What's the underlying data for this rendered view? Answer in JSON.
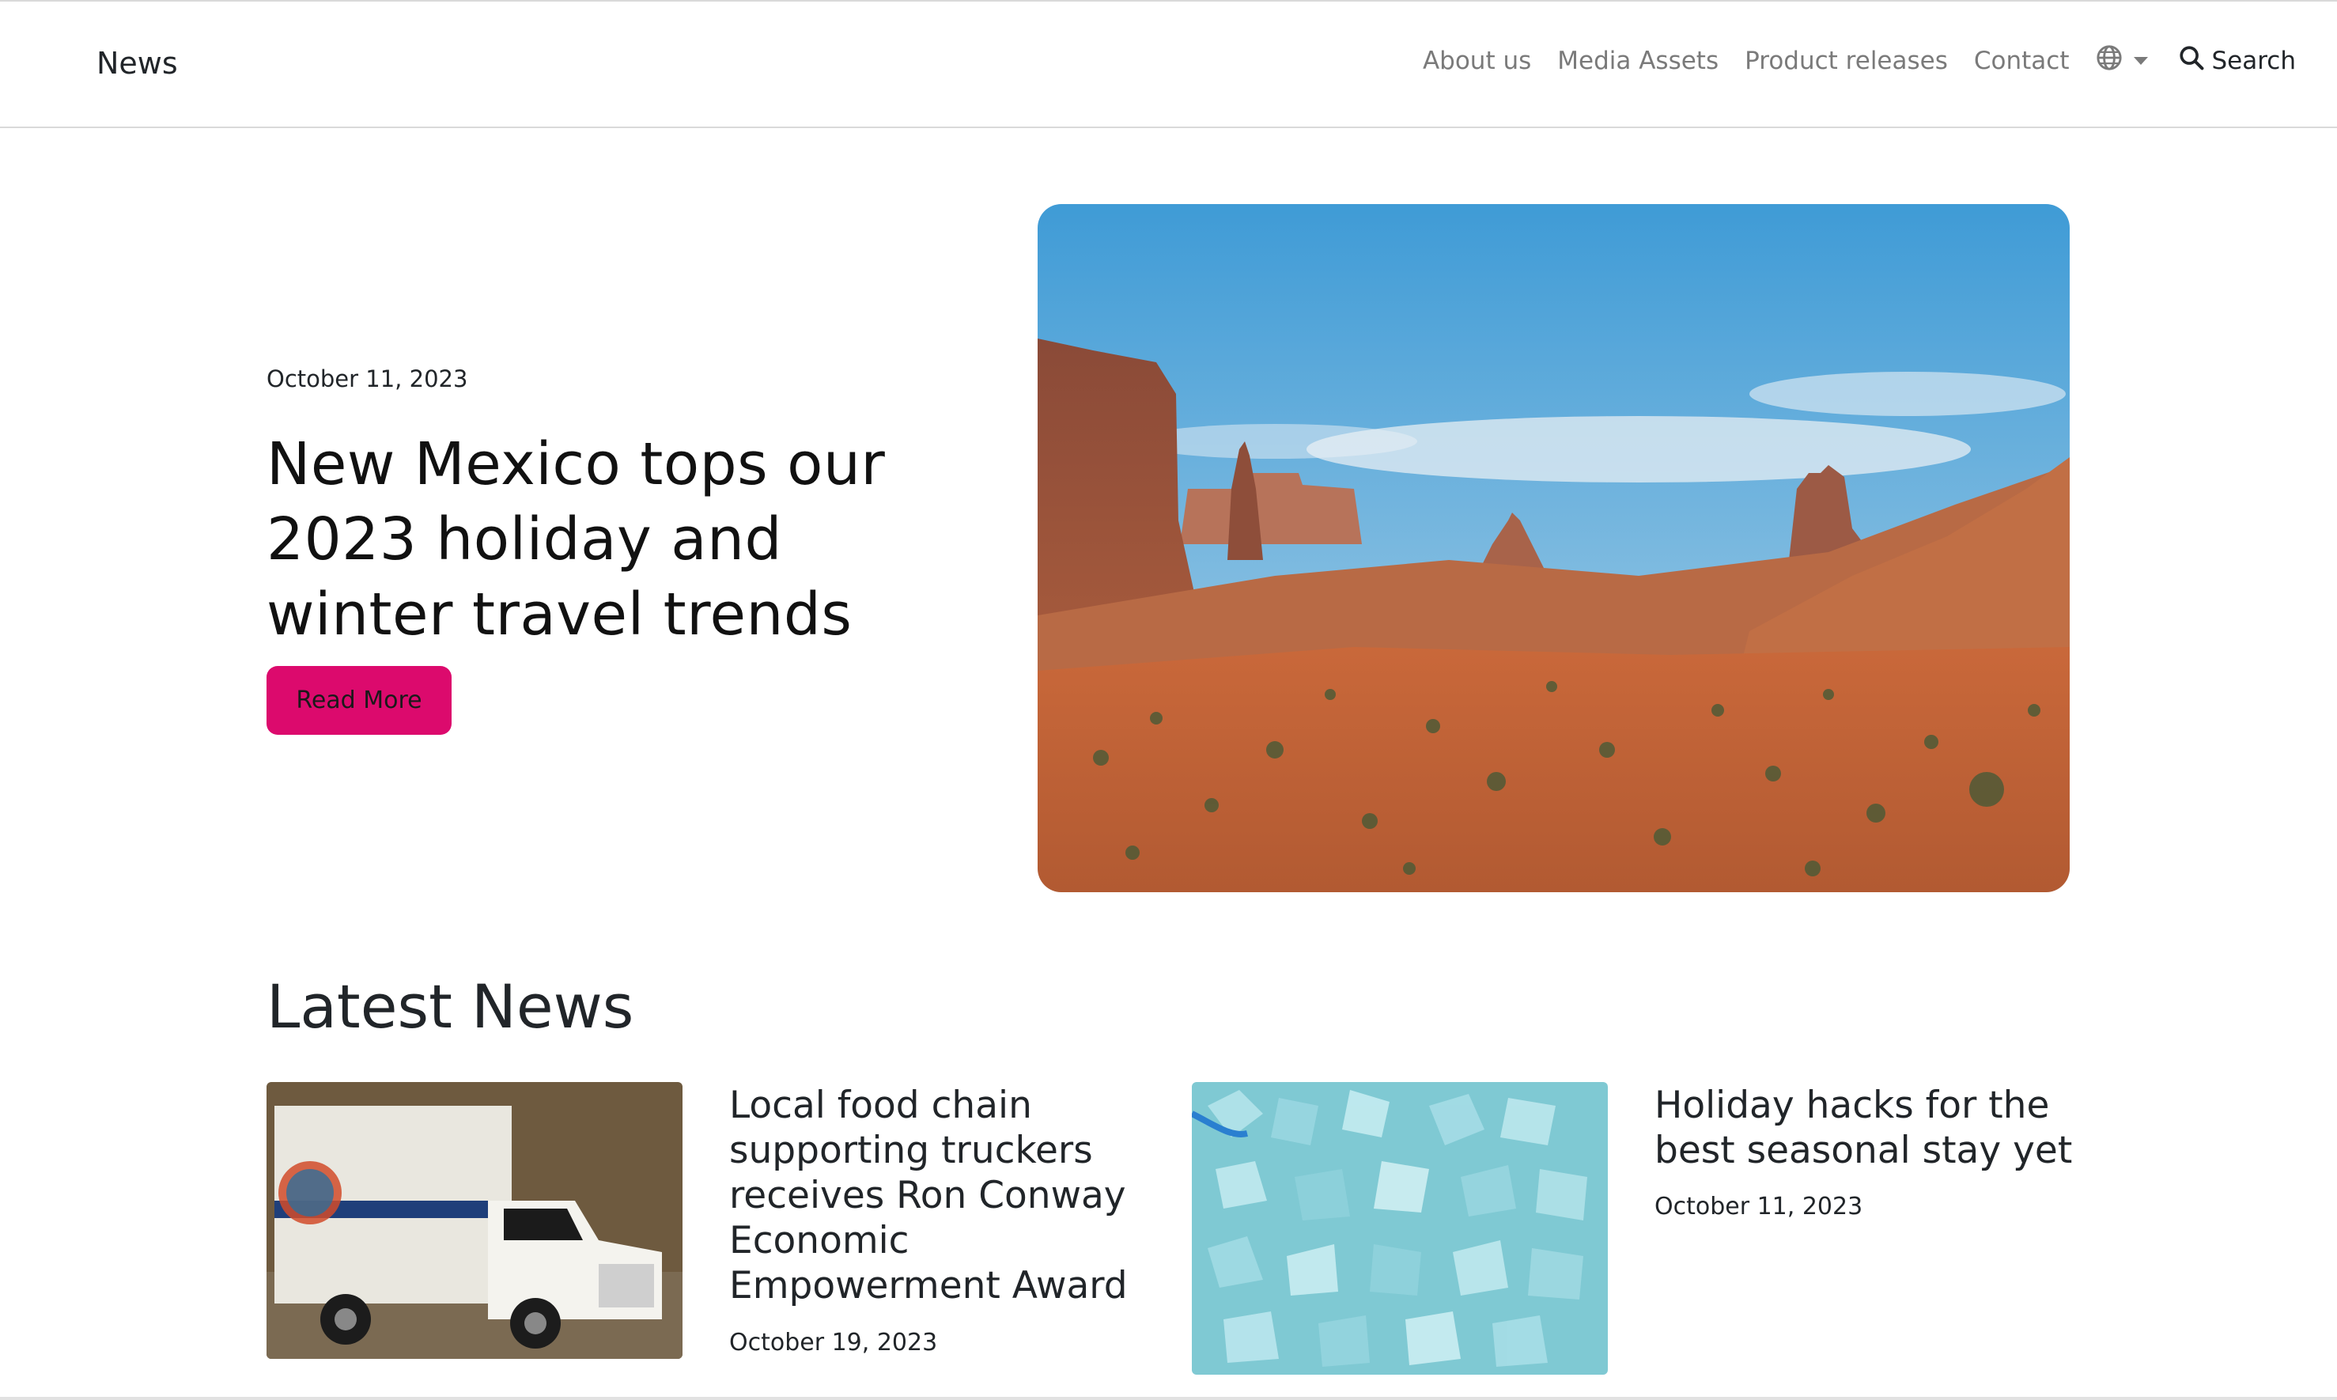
{
  "navbar": {
    "brand": "News",
    "links": [
      "About us",
      "Media Assets",
      "Product releases",
      "Contact"
    ],
    "search_label": "Search",
    "language_icon": "globe-icon"
  },
  "hero": {
    "date": "October 11, 2023",
    "title": "New Mexico tops our 2023 holiday and winter travel trends",
    "button_label": "Read More",
    "image": "desert-landscape-photo"
  },
  "latest": {
    "heading": "Latest News",
    "articles": [
      {
        "title": "Local food chain supporting truckers receives Ron Conway Economic Empowerment Award",
        "date": "October 19, 2023",
        "image": "delivery-truck-photo"
      },
      {
        "title": "Holiday hacks for the best seasonal stay yet",
        "date": "October 11, 2023",
        "image": "blue-crystals-photo"
      }
    ]
  },
  "colors": {
    "accent": "#dc0a6d",
    "nav_text": "#7a7a7a",
    "text": "#212529"
  }
}
